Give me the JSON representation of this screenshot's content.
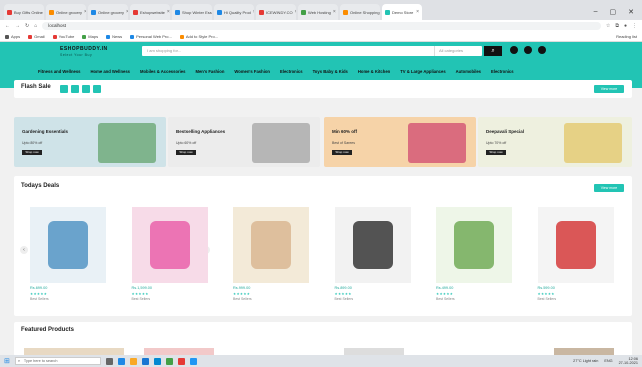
{
  "browser": {
    "tabs": [
      {
        "label": "Buy Gifts Online",
        "color": "#e53935"
      },
      {
        "label": "Online grocery",
        "color": "#fb8c00"
      },
      {
        "label": "Online grocery",
        "color": "#1e88e5"
      },
      {
        "label": "Eshopwebsite",
        "color": "#e53935"
      },
      {
        "label": "Shop Winter Ess",
        "color": "#1e88e5"
      },
      {
        "label": "Hi Quality Prod",
        "color": "#1e88e5"
      },
      {
        "label": "ICEWINDY.CO",
        "color": "#e53935"
      },
      {
        "label": "Web Hosting",
        "color": "#43a047"
      },
      {
        "label": "Online Shopping",
        "color": "#fb8c00"
      },
      {
        "label": "Demo Store",
        "color": "#22c4b4"
      }
    ],
    "active_tab": 9,
    "url": "localhost",
    "bookmarks": [
      {
        "label": "Apps",
        "color": "#555"
      },
      {
        "label": "Gmail",
        "color": "#e53935"
      },
      {
        "label": "YouTube",
        "color": "#e53935"
      },
      {
        "label": "Maps",
        "color": "#43a047"
      },
      {
        "label": "News",
        "color": "#1e88e5"
      },
      {
        "label": "Personal Web Pro...",
        "color": "#1e88e5"
      },
      {
        "label": "Add to Style Pro...",
        "color": "#fb8c00"
      }
    ],
    "reading_list": "Reading list"
  },
  "site": {
    "logo": "ESHOPBUDDY.IN",
    "tagline": "Select Your Buy",
    "search_placeholder": "I am shopping for...",
    "category_select": "All categories",
    "categories": [
      "Fitness and Wellness",
      "Home and Wellness",
      "Mobiles & Accessories",
      "Men's Fashion",
      "Women's Fashion",
      "Electronics",
      "Toys Baby & Kids",
      "Home & Kitchen",
      "TV & Large Appliances",
      "Automobiles",
      "Electronics"
    ]
  },
  "flash_sale": {
    "title": "Flash Sale",
    "view_all": "View more"
  },
  "banners": [
    {
      "title": "Gardening Essentials",
      "price": "Upto 80% off",
      "button": "Shop now",
      "bg": "#cfe3e8"
    },
    {
      "title": "Bestselling Appliances",
      "price": "Upto 60% off",
      "button": "Shop now",
      "bg": "#ececec"
    },
    {
      "title": "Min 60% off",
      "price": "Best of Sarees",
      "button": "Shop now",
      "bg": "#f6d3a8"
    },
    {
      "title": "Deepavali Special",
      "price": "Upto 70% off",
      "button": "Shop now",
      "bg": "#eef0df"
    }
  ],
  "deals": {
    "title": "Todays Deals",
    "view_all": "View more",
    "products": [
      {
        "price": "Rs.699.00",
        "stars": "★★★★★",
        "meta": "Best Sellers"
      },
      {
        "price": "Rs.1,599.00",
        "stars": "★★★★★",
        "meta": "Best Sellers"
      },
      {
        "price": "Rs.999.00",
        "stars": "★★★★★",
        "meta": "Best Sellers"
      },
      {
        "price": "Rs.899.00",
        "stars": "★★★★★",
        "meta": "Best Sellers"
      },
      {
        "price": "Rs.499.00",
        "stars": "★★★★★",
        "meta": "Best Sellers"
      },
      {
        "price": "Rs.599.00",
        "stars": "★★★★★",
        "meta": "Best Sellers"
      }
    ]
  },
  "featured": {
    "title": "Featured Products"
  },
  "taskbar": {
    "search_placeholder": "Type here to search",
    "weather": "27°C Light rain",
    "time": "12:06",
    "date": "27-10-2021",
    "lang": "ENG"
  }
}
